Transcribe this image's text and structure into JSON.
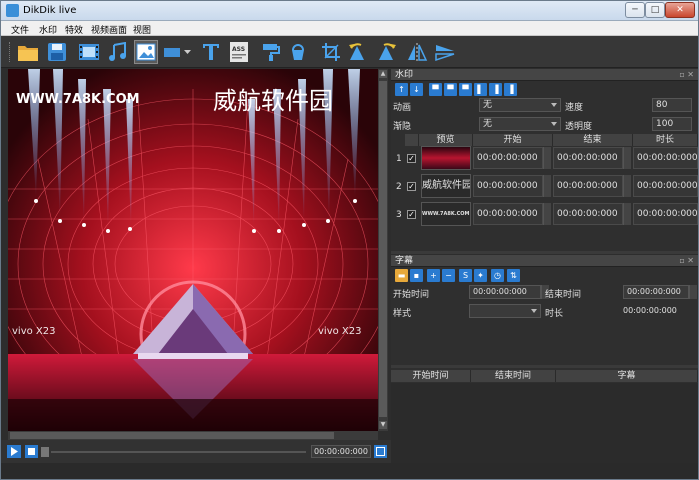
{
  "window": {
    "title": "DikDik live",
    "min": "─",
    "max": "□",
    "close": "✕"
  },
  "menu": [
    "文件",
    "水印",
    "特效",
    "视频画面",
    "视图"
  ],
  "video": {
    "url_overlay": "WWW.7A8K.COM",
    "cn_overlay": "威航软件园",
    "brand_left": "vivo X23",
    "brand_right": "vivo X23"
  },
  "player": {
    "time": "00:00:00:000"
  },
  "watermark": {
    "title": "水印",
    "anim_label": "动画",
    "anim_value": "无",
    "speed_label": "速度",
    "speed_value": "80",
    "fade_label": "渐隐",
    "fade_value": "无",
    "opacity_label": "透明度",
    "opacity_value": "100",
    "columns": [
      "预览",
      "开始",
      "结束",
      "时长"
    ],
    "rows": [
      {
        "num": "1",
        "check": "✓",
        "preview": "",
        "start": "00:00:00:000",
        "end": "00:00:00:000",
        "duration": "00:00:00:000"
      },
      {
        "num": "2",
        "check": "✓",
        "preview": "威航软件园",
        "start": "00:00:00:000",
        "end": "00:00:00:000",
        "duration": "00:00:00:000"
      },
      {
        "num": "3",
        "check": "✓",
        "preview": "WWW.7A8K.COM",
        "start": "00:00:00:000",
        "end": "00:00:00:000",
        "duration": "00:00:00:000"
      }
    ]
  },
  "subtitle": {
    "title": "字幕",
    "start_label": "开始时间",
    "start_value": "00:00:00:000",
    "end_label": "结束时间",
    "end_value": "00:00:00:000",
    "style_label": "样式",
    "style_value": "",
    "duration_label": "时长",
    "duration_value": "00:00:00:000",
    "columns": [
      "开始时间",
      "结束时间",
      "字幕"
    ]
  }
}
